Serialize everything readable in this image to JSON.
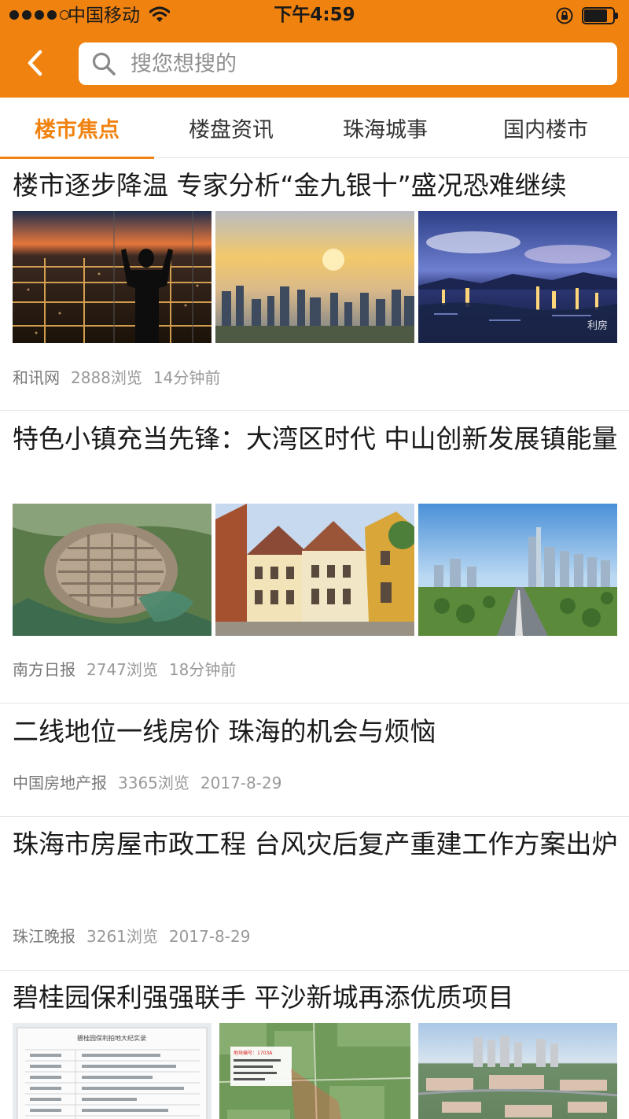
{
  "status_bar": {
    "carrier": "中国移动",
    "time": "下午4:59",
    "signal_bars_filled": 4,
    "signal_bars_total": 5,
    "battery_level": 0.85
  },
  "nav": {
    "back_icon": "chevron-left-icon",
    "search_icon": "search-icon",
    "search_placeholder": "搜您想搜的"
  },
  "tabs": [
    {
      "label": "楼市焦点",
      "active": true
    },
    {
      "label": "楼盘资讯",
      "active": false
    },
    {
      "label": "珠海城事",
      "active": false
    },
    {
      "label": "国内楼市",
      "active": false
    }
  ],
  "articles": [
    {
      "title": "楼市逐步降温 专家分析“金九银十”盛况恐难继续",
      "source": "和讯网",
      "views": "2888浏览",
      "time": "14分钟前",
      "thumbnails": [
        "night-city-window-silhouette",
        "sunset-skyline",
        "harbor-city-night"
      ],
      "watermark": "利房"
    },
    {
      "title": "特色小镇充当先锋：大湾区时代 中山创新发展镇能量",
      "source": "南方日报",
      "views": "2747浏览",
      "time": "18分钟前",
      "thumbnails": [
        "aerial-old-town",
        "european-style-houses",
        "modern-city-boulevard"
      ]
    },
    {
      "title": "二线地位一线房价 珠海的机会与烦恼",
      "source": "中国房地产报",
      "views": "3365浏览",
      "time": "2017-8-29",
      "thumbnails": []
    },
    {
      "title": "珠海市房屋市政工程 台风灾后复产重建工作方案出炉",
      "source": "珠江晚报",
      "views": "3261浏览",
      "time": "2017-8-29",
      "thumbnails": []
    },
    {
      "title": "碧桂园保利强强联手 平沙新城再添优质项目",
      "source": "",
      "views": "",
      "time": "",
      "thumbnails": [
        "land-auction-document",
        "aerial-land-plot-map",
        "aerial-new-town"
      ],
      "doc_heading": "碧桂园保利拍地大纪实录",
      "map_label": "地块编号：1703A"
    }
  ]
}
